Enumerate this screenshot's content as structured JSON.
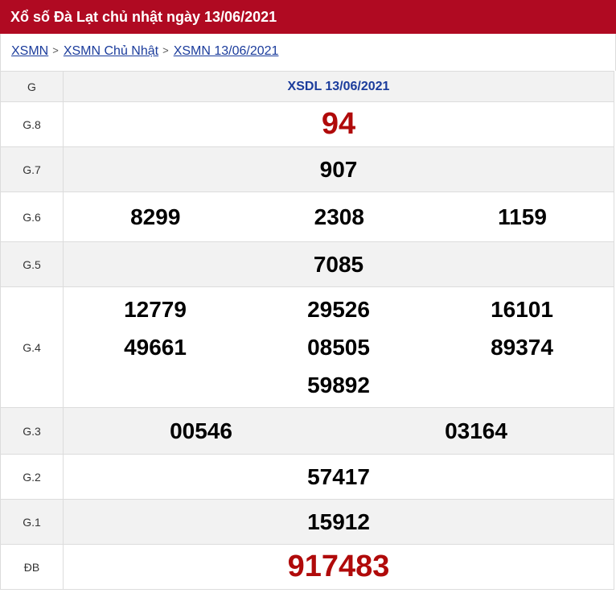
{
  "page": {
    "title": "Xổ số Đà Lạt chủ nhật ngày 13/06/2021"
  },
  "breadcrumb": {
    "items": [
      "XSMN",
      "XSMN Chủ Nhật",
      "XSMN 13/06/2021"
    ],
    "separator": ">"
  },
  "table": {
    "col_prize_header": "G",
    "col_result_header": "XSDL 13/06/2021",
    "rows": [
      {
        "label": "G.8",
        "numbers": [
          "94"
        ]
      },
      {
        "label": "G.7",
        "numbers": [
          "907"
        ]
      },
      {
        "label": "G.6",
        "numbers": [
          "8299",
          "2308",
          "1159"
        ]
      },
      {
        "label": "G.5",
        "numbers": [
          "7085"
        ]
      },
      {
        "label": "G.4",
        "numbers": [
          "12779",
          "29526",
          "16101",
          "49661",
          "08505",
          "89374",
          "59892"
        ]
      },
      {
        "label": "G.3",
        "numbers": [
          "00546",
          "03164"
        ]
      },
      {
        "label": "G.2",
        "numbers": [
          "57417"
        ]
      },
      {
        "label": "G.1",
        "numbers": [
          "15912"
        ]
      },
      {
        "label": "ĐB",
        "numbers": [
          "917483"
        ]
      }
    ]
  },
  "colors": {
    "header_bg": "#b00a22",
    "link": "#1b3c9c",
    "highlight_number": "#b00a0a",
    "alt_row_bg": "#f2f2f2"
  }
}
